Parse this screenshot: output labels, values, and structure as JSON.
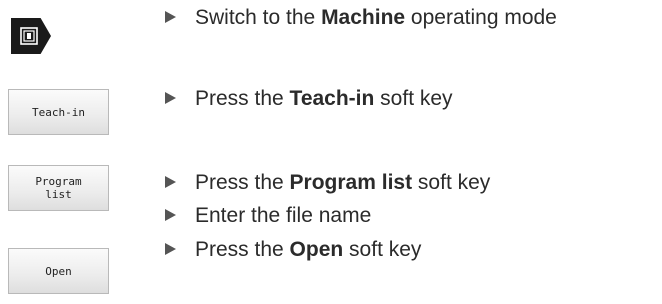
{
  "keys": {
    "machine_icon": "machine-mode-icon",
    "teach_in": "Teach-in",
    "program_list": "Program\nlist",
    "open": "Open"
  },
  "steps": [
    {
      "pre": "Switch to the ",
      "bold": "Machine",
      "post": " operating mode"
    },
    {
      "pre": "Press the ",
      "bold": "Teach-in",
      "post": " soft key"
    },
    {
      "pre": "Press the ",
      "bold": "Program list",
      "post": " soft key"
    },
    {
      "pre": "Enter the file name",
      "bold": "",
      "post": ""
    },
    {
      "pre": "Press the ",
      "bold": "Open",
      "post": " soft key"
    }
  ]
}
